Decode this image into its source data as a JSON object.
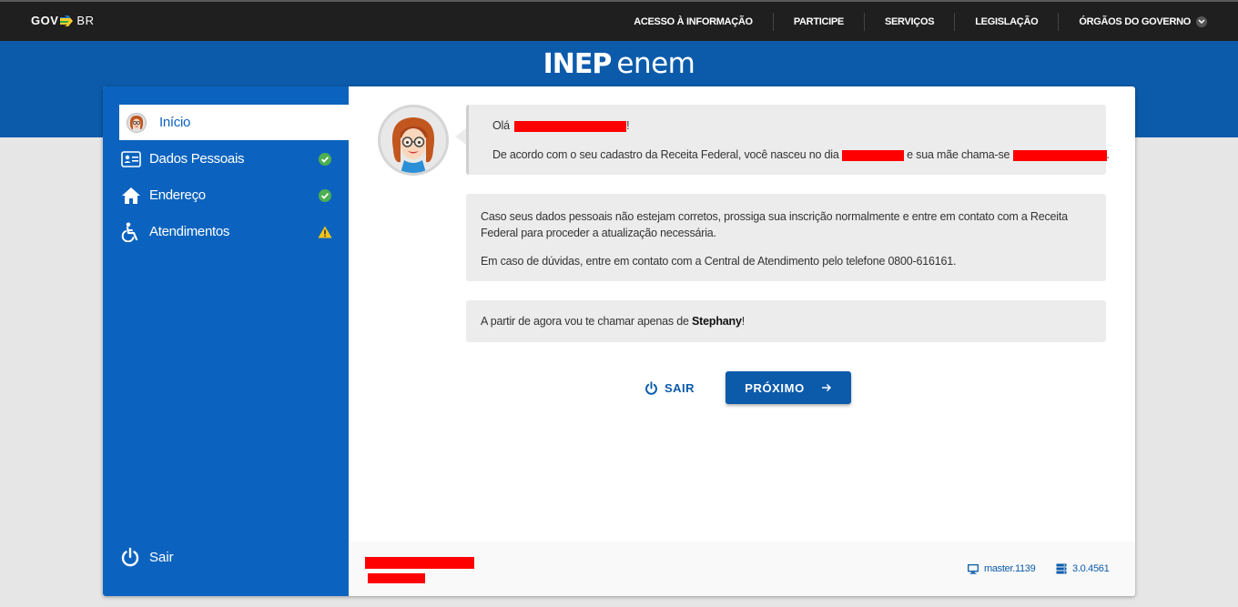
{
  "topbar": {
    "logo_gov": "GOV",
    "logo_br": "BR",
    "nav": [
      {
        "label": "ACESSO À INFORMAÇÃO"
      },
      {
        "label": "PARTICIPE"
      },
      {
        "label": "SERVIÇOS"
      },
      {
        "label": "LEGISLAÇÃO"
      },
      {
        "label": "ÓRGÃOS DO GOVERNO"
      }
    ]
  },
  "brand": {
    "inep": "INEP",
    "enem": "enem"
  },
  "sidebar": {
    "items": [
      {
        "label": "Início",
        "icon": "avatar-icon",
        "status": ""
      },
      {
        "label": "Dados Pessoais",
        "icon": "id-card-icon",
        "status": "check-icon"
      },
      {
        "label": "Endereço",
        "icon": "home-icon",
        "status": "check-icon"
      },
      {
        "label": "Atendimentos",
        "icon": "wheelchair-icon",
        "status": "warning-icon"
      }
    ],
    "exit_label": "Sair"
  },
  "messages": {
    "greeting": "Olá",
    "greeting_end": "!",
    "cadastro_a": "De acordo com o seu cadastro da Receita Federal, você nasceu no dia",
    "cadastro_b": "e sua mãe chama-se",
    "cadastro_end": ".",
    "info_1": "Caso seus dados pessoais não estejam corretos, prossiga sua inscrição normalmente e entre em contato com a Receita Federal para proceder a atualização necessária.",
    "info_2": "Em caso de dúvidas, entre em contato com a Central de Atendimento pelo telefone 0800-616161.",
    "nickname_prefix": "A partir de agora vou te chamar apenas de",
    "nickname": "Stephany",
    "nickname_end": "!"
  },
  "actions": {
    "exit_label": "SAIR",
    "next_label": "PRÓXIMO"
  },
  "footer": {
    "build": "master.1139",
    "version": "3.0.4561"
  },
  "colors": {
    "primary": "#0c5bab",
    "sidebar": "#0c63bf",
    "success": "#4caf50",
    "warning": "#f5c518"
  }
}
